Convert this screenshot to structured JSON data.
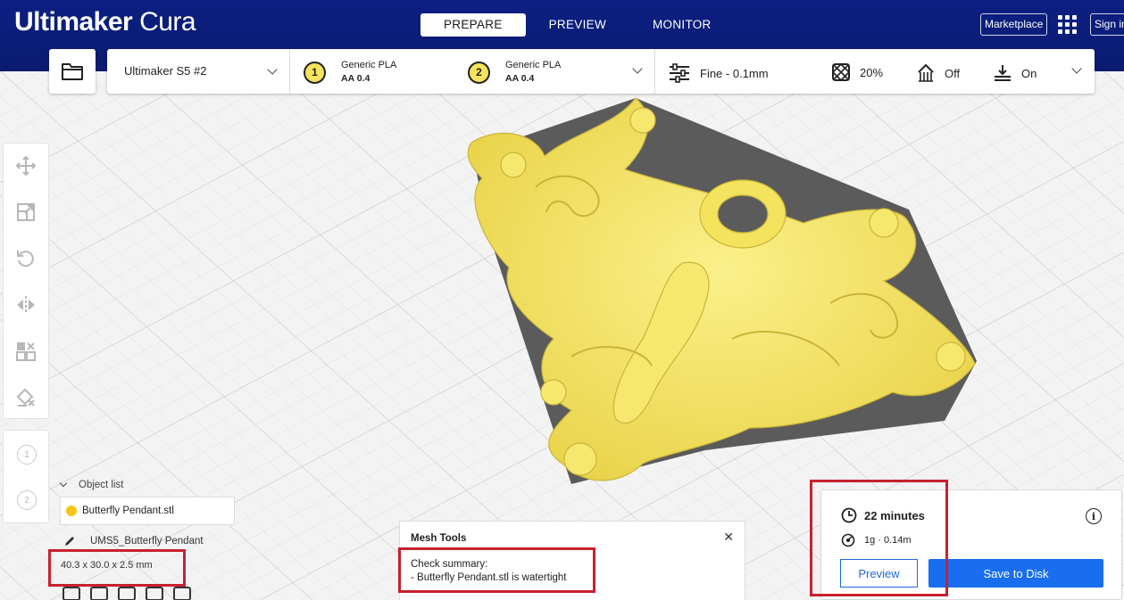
{
  "app": {
    "brand_bold": "Ultimaker",
    "brand_light": "Cura"
  },
  "stages": [
    {
      "label": "PREPARE",
      "active": true
    },
    {
      "label": "PREVIEW",
      "active": false
    },
    {
      "label": "MONITOR",
      "active": false
    }
  ],
  "header": {
    "marketplace_label": "Marketplace",
    "signin_label": "Sign in"
  },
  "toolbar": {
    "printer": "Ultimaker S5 #2",
    "extruders": [
      {
        "index": "1",
        "material": "Generic PLA",
        "core": "AA 0.4"
      },
      {
        "index": "2",
        "material": "Generic PLA",
        "core": "AA 0.4"
      }
    ],
    "profile": "Fine - 0.1mm",
    "infill": "20%",
    "support": "Off",
    "adhesion": "On"
  },
  "left_tools": [
    "move-tool-icon",
    "scale-tool-icon",
    "rotate-tool-icon",
    "mirror-tool-icon",
    "per-model-settings-icon",
    "support-blocker-icon"
  ],
  "extruder_mini": [
    "1",
    "2"
  ],
  "object_list": {
    "header": "Object list",
    "items": [
      {
        "name": "Butterfly Pendant.stl",
        "color": "#f5c518"
      }
    ],
    "job_name": "UMS5_Butterfly Pendant",
    "dimensions": "40.3 x 30.0 x 2.5 mm"
  },
  "mesh_tools": {
    "title": "Mesh Tools",
    "summary_label": "Check summary:",
    "summary_line": "- Butterfly Pendant.stl is watertight"
  },
  "print_info": {
    "time": "22 minutes",
    "material": "1g · 0.14m",
    "preview_label": "Preview",
    "save_label": "Save to Disk"
  },
  "colors": {
    "header_bg": "#0a1e7a",
    "model_yellow": "#f3e36a",
    "accent_blue": "#196ef0",
    "highlight_red": "#c8202e"
  }
}
